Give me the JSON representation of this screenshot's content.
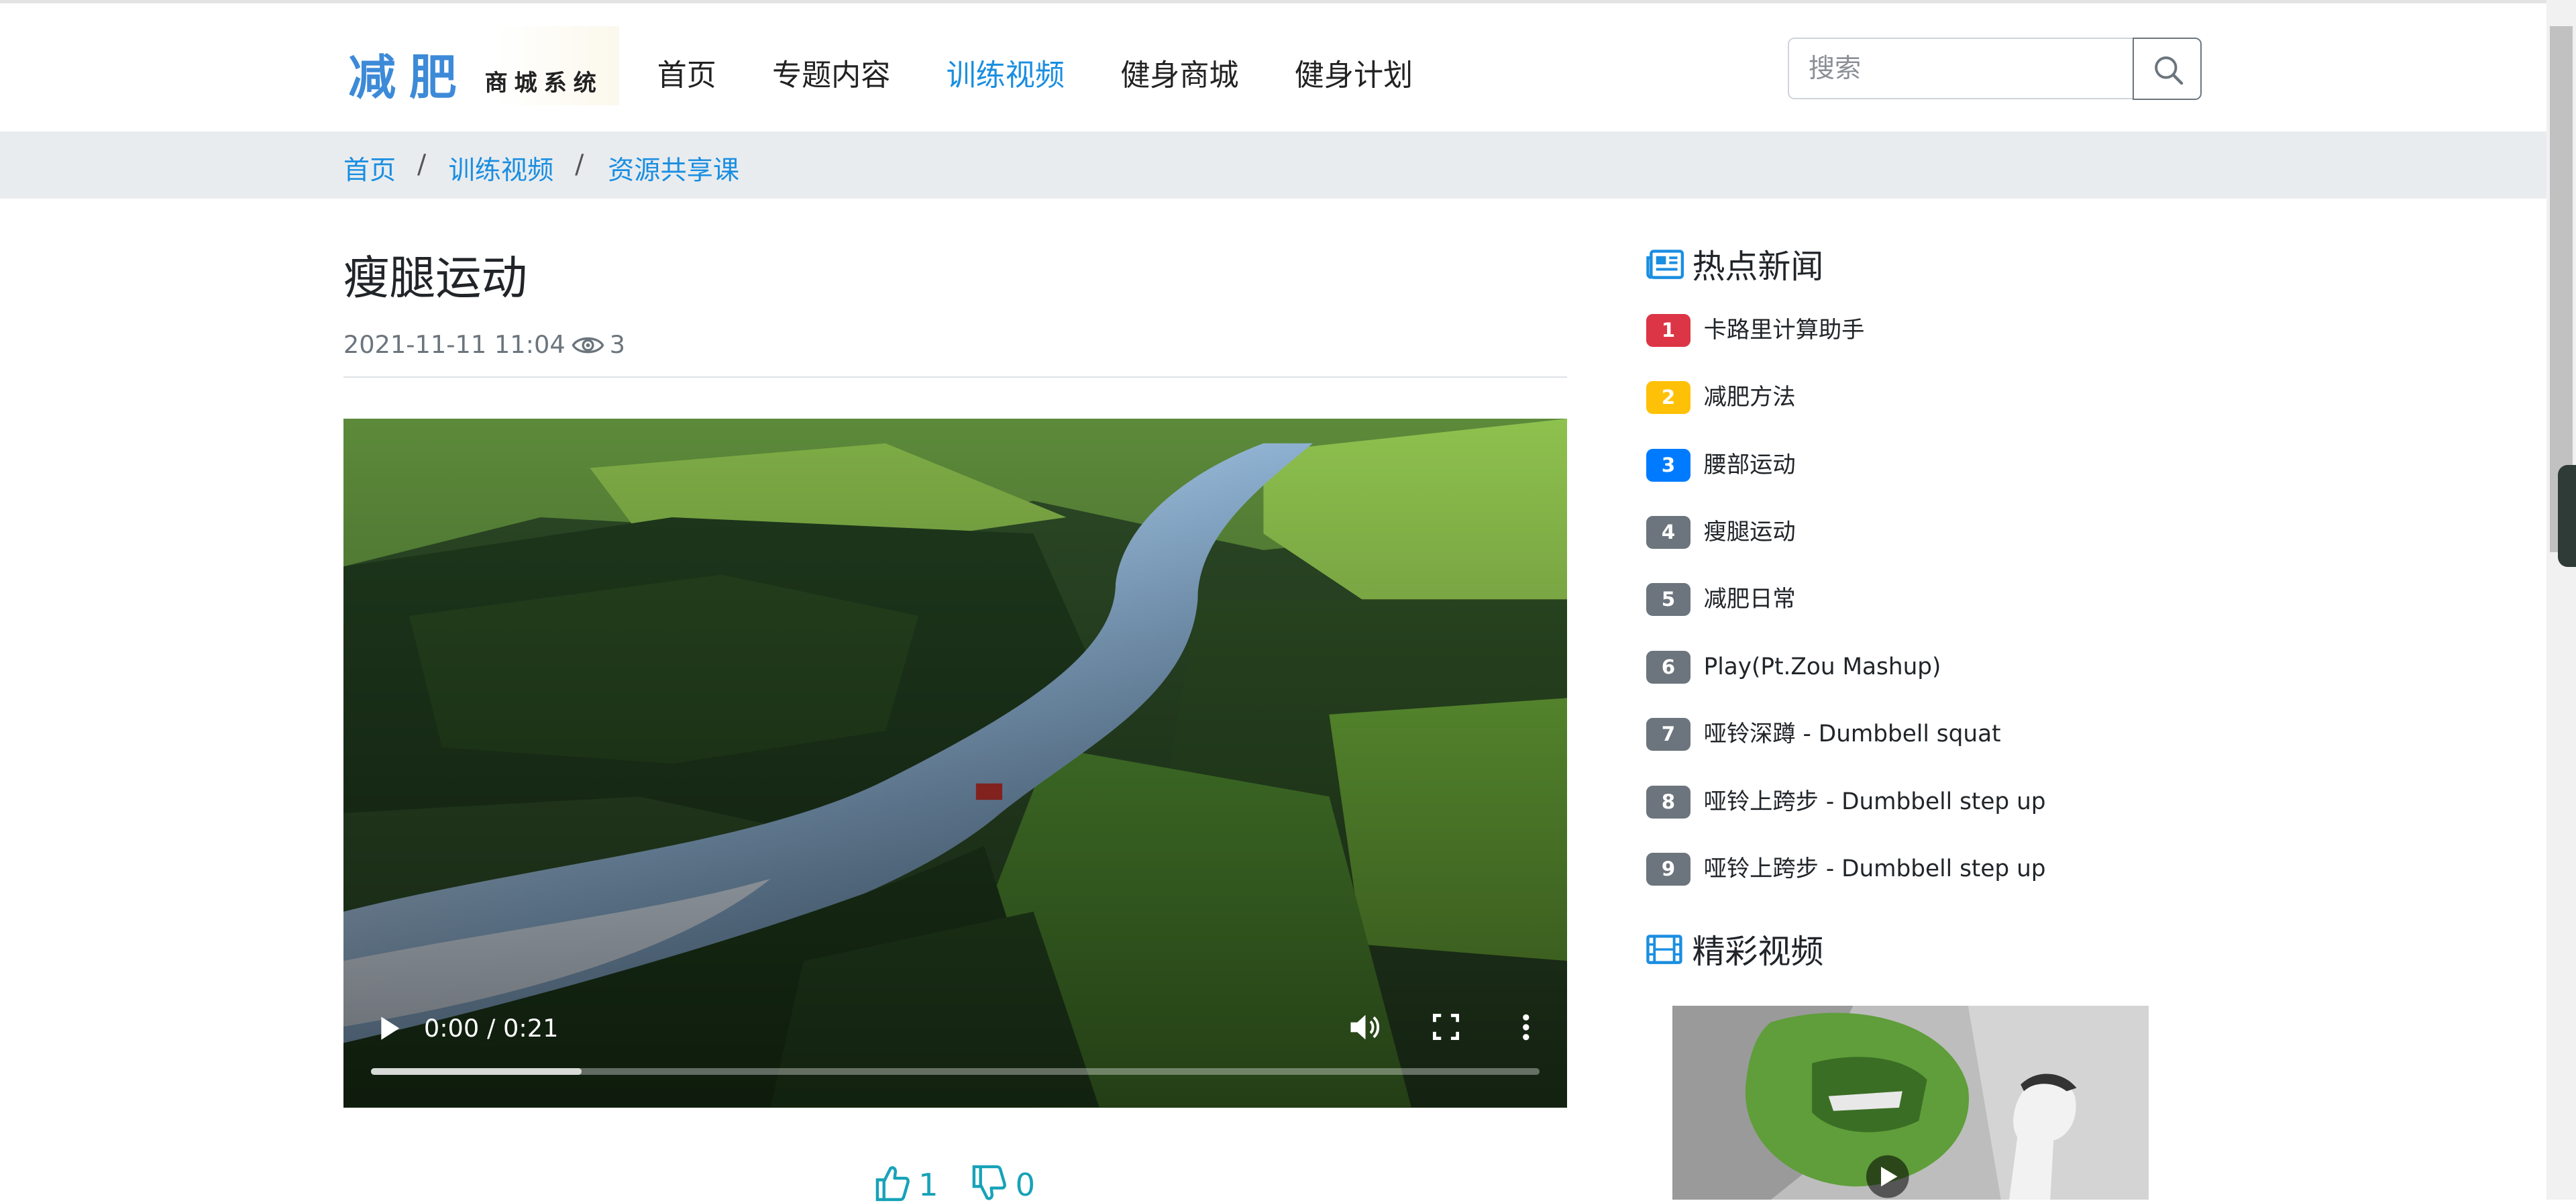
{
  "brand": {
    "main": "减肥",
    "sub": "商城系统"
  },
  "nav": [
    {
      "label": "首页",
      "active": false
    },
    {
      "label": "专题内容",
      "active": false
    },
    {
      "label": "训练视频",
      "active": true
    },
    {
      "label": "健身商城",
      "active": false
    },
    {
      "label": "健身计划",
      "active": false
    }
  ],
  "search": {
    "placeholder": "搜索",
    "value": ""
  },
  "breadcrumb": [
    "首页",
    "训练视频",
    "资源共享课"
  ],
  "article": {
    "title": "瘦腿运动",
    "date": "2021-11-11 11:04",
    "views": "3"
  },
  "video": {
    "time": "0:00 / 0:21",
    "buffered_fraction": 0.18
  },
  "votes": {
    "likes": "1",
    "dislikes": "0"
  },
  "hot_news": {
    "heading": "热点新闻",
    "items": [
      {
        "rank": "1",
        "title": "卡路里计算助手",
        "color": "#dc3545"
      },
      {
        "rank": "2",
        "title": "减肥方法",
        "color": "#ffc107"
      },
      {
        "rank": "3",
        "title": "腰部运动",
        "color": "#007bff"
      },
      {
        "rank": "4",
        "title": "瘦腿运动",
        "color": "#6c757d"
      },
      {
        "rank": "5",
        "title": "减肥日常",
        "color": "#6c757d"
      },
      {
        "rank": "6",
        "title": "Play(Pt.Zou Mashup)",
        "color": "#6c757d"
      },
      {
        "rank": "7",
        "title": "哑铃深蹲 - Dumbbell squat",
        "color": "#6c757d"
      },
      {
        "rank": "8",
        "title": "哑铃上跨步 - Dumbbell step up",
        "color": "#6c757d"
      },
      {
        "rank": "9",
        "title": "哑铃上跨步 - Dumbbell step up",
        "color": "#6c757d"
      }
    ]
  },
  "featured_videos": {
    "heading": "精彩视频"
  },
  "colors": {
    "accent": "#1a8ee1",
    "vote": "#17a2b8",
    "breadcrumb_bg": "#e9ecef"
  },
  "icons": [
    "search-icon",
    "eye-icon",
    "play-icon",
    "volume-icon",
    "fullscreen-icon",
    "more-vert-icon",
    "thumbs-up-icon",
    "thumbs-down-icon",
    "newspaper-icon",
    "film-icon"
  ]
}
